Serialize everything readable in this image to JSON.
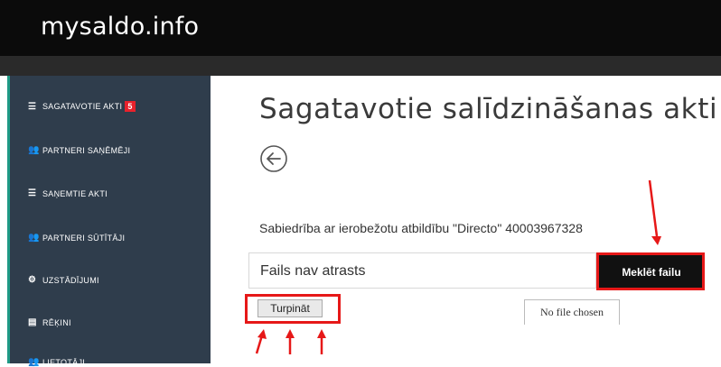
{
  "brand": "mysaldo.info",
  "sidebar": {
    "items": [
      {
        "label": "SAGATAVOTIE AKTI",
        "icon": "list-icon",
        "badge": "5"
      },
      {
        "label": "PARTNERI SAŅĒMĒJI",
        "icon": "users-icon"
      },
      {
        "label": "SAŅEMTIE AKTI",
        "icon": "list-icon"
      },
      {
        "label": "PARTNERI SŪTĪTĀJI",
        "icon": "users-icon"
      },
      {
        "label": "UZSTĀDĪJUMI",
        "icon": "cogs-icon"
      },
      {
        "label": "RĒĶINI",
        "icon": "file-icon"
      },
      {
        "label": "LIETOTĀJI",
        "icon": "users-icon"
      }
    ]
  },
  "main": {
    "title": "Sagatavotie salīdzināšanas akti",
    "company": "Sabiedrība ar ierobežotu atbildību \"Directo\" 40003967328",
    "file_status": "Fails nav atrasts",
    "search_button": "Meklēt failu",
    "continue_button": "Turpināt",
    "no_file": "No file chosen"
  },
  "colors": {
    "topbar": "#0b0b0b",
    "sidebar": "#2f3d4c",
    "sidebar_accent": "#1f9a86",
    "badge": "#e8222c",
    "annotation": "#e61818"
  }
}
